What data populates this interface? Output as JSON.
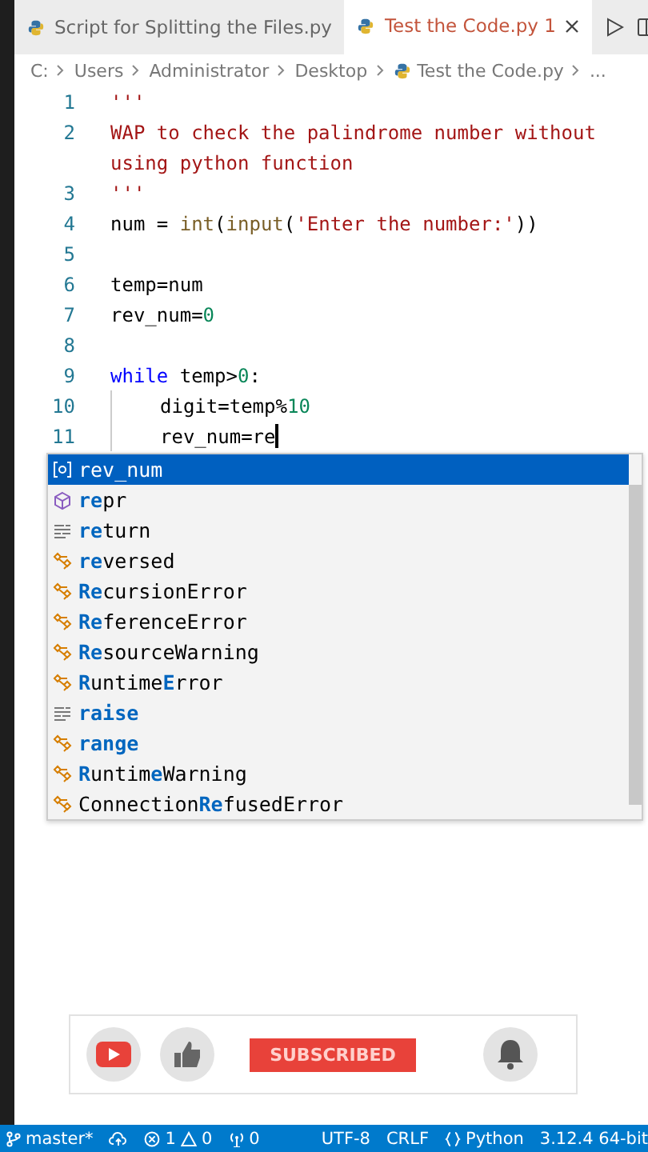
{
  "tabs": [
    {
      "label": "Script for Splitting the Files.py",
      "selected": false
    },
    {
      "label": "Test the Code.py",
      "selected": true,
      "badge": "1"
    }
  ],
  "breadcrumb": [
    "C:",
    "Users",
    "Administrator",
    "Desktop",
    "Test the Code.py",
    "..."
  ],
  "code": [
    {
      "number": "1",
      "tokens": [
        {
          "text": "'''",
          "kind": "string"
        }
      ]
    },
    {
      "number": "2",
      "tokens": [
        {
          "text": "WAP to check the palindrome number without",
          "kind": "string"
        }
      ]
    },
    {
      "tokens": [
        {
          "text": "using python function",
          "kind": "string"
        }
      ]
    },
    {
      "number": "3",
      "tokens": [
        {
          "text": "'''",
          "kind": "string"
        }
      ]
    },
    {
      "number": "4",
      "tokens": [
        {
          "text": "num = ",
          "kind": "plain"
        },
        {
          "text": "int",
          "kind": "func"
        },
        {
          "text": "(",
          "kind": "plain"
        },
        {
          "text": "input",
          "kind": "func"
        },
        {
          "text": "(",
          "kind": "plain"
        },
        {
          "text": "'Enter the number:'",
          "kind": "string"
        },
        {
          "text": "))",
          "kind": "plain"
        }
      ]
    },
    {
      "number": "5"
    },
    {
      "number": "6",
      "tokens": [
        {
          "text": "temp=num",
          "kind": "plain"
        }
      ]
    },
    {
      "number": "7",
      "tokens": [
        {
          "text": "rev_num=",
          "kind": "plain"
        },
        {
          "text": "0",
          "kind": "number"
        }
      ]
    },
    {
      "number": "8"
    },
    {
      "number": "9",
      "tokens": [
        {
          "text": "while",
          "kind": "keyword"
        },
        {
          "text": " temp>",
          "kind": "plain"
        },
        {
          "text": "0",
          "kind": "number"
        },
        {
          "text": ":",
          "kind": "plain"
        }
      ]
    },
    {
      "number": "10",
      "indent": true,
      "tokens": [
        {
          "text": "digit=temp%",
          "kind": "plain"
        },
        {
          "text": "10",
          "kind": "number"
        }
      ]
    },
    {
      "number": "11",
      "indent": true,
      "tokens": [
        {
          "text": "rev_num=re",
          "kind": "plain"
        }
      ]
    }
  ],
  "suggestions": [
    {
      "kind": "variable",
      "selected": true,
      "parts": [
        {
          "text": "rev_num",
          "match": false
        }
      ]
    },
    {
      "kind": "module",
      "selected": false,
      "parts": [
        {
          "text": "re",
          "match": true
        },
        {
          "text": "pr",
          "match": false
        }
      ]
    },
    {
      "kind": "keyword",
      "selected": false,
      "parts": [
        {
          "text": "re",
          "match": true
        },
        {
          "text": "turn",
          "match": false
        }
      ]
    },
    {
      "kind": "class",
      "selected": false,
      "parts": [
        {
          "text": "re",
          "match": true
        },
        {
          "text": "versed",
          "match": false
        }
      ]
    },
    {
      "kind": "class",
      "selected": false,
      "parts": [
        {
          "text": "Re",
          "match": true
        },
        {
          "text": "cursionError",
          "match": false
        }
      ]
    },
    {
      "kind": "class",
      "selected": false,
      "parts": [
        {
          "text": "Re",
          "match": true
        },
        {
          "text": "ferenceError",
          "match": false
        }
      ]
    },
    {
      "kind": "class",
      "selected": false,
      "parts": [
        {
          "text": "Re",
          "match": true
        },
        {
          "text": "sourceWarning",
          "match": false
        }
      ]
    },
    {
      "kind": "class",
      "selected": false,
      "parts": [
        {
          "text": "R",
          "match": true
        },
        {
          "text": "untime",
          "match": false
        },
        {
          "text": "E",
          "match": true
        },
        {
          "text": "rror",
          "match": false
        }
      ]
    },
    {
      "kind": "keyword",
      "selected": false,
      "parts": [
        {
          "text": "raise",
          "match": true
        }
      ]
    },
    {
      "kind": "class",
      "selected": false,
      "parts": [
        {
          "text": "range",
          "match": true
        }
      ]
    },
    {
      "kind": "class",
      "selected": false,
      "parts": [
        {
          "text": "R",
          "match": true
        },
        {
          "text": "untim",
          "match": false
        },
        {
          "text": "e",
          "match": true
        },
        {
          "text": "Warning",
          "match": false
        }
      ]
    },
    {
      "kind": "class",
      "selected": false,
      "parts": [
        {
          "text": "Connection",
          "match": false
        },
        {
          "text": "Re",
          "match": true
        },
        {
          "text": "fusedError",
          "match": false
        }
      ]
    }
  ],
  "subscribe_overlay": {
    "button": "SUBSCRIBED"
  },
  "status_bar": {
    "branch": "master*",
    "errors": "1",
    "warnings": "0",
    "ports": "0",
    "encoding": "UTF-8",
    "eol": "CRLF",
    "language": "Python",
    "interpreter": "3.12.4 64-bit"
  }
}
